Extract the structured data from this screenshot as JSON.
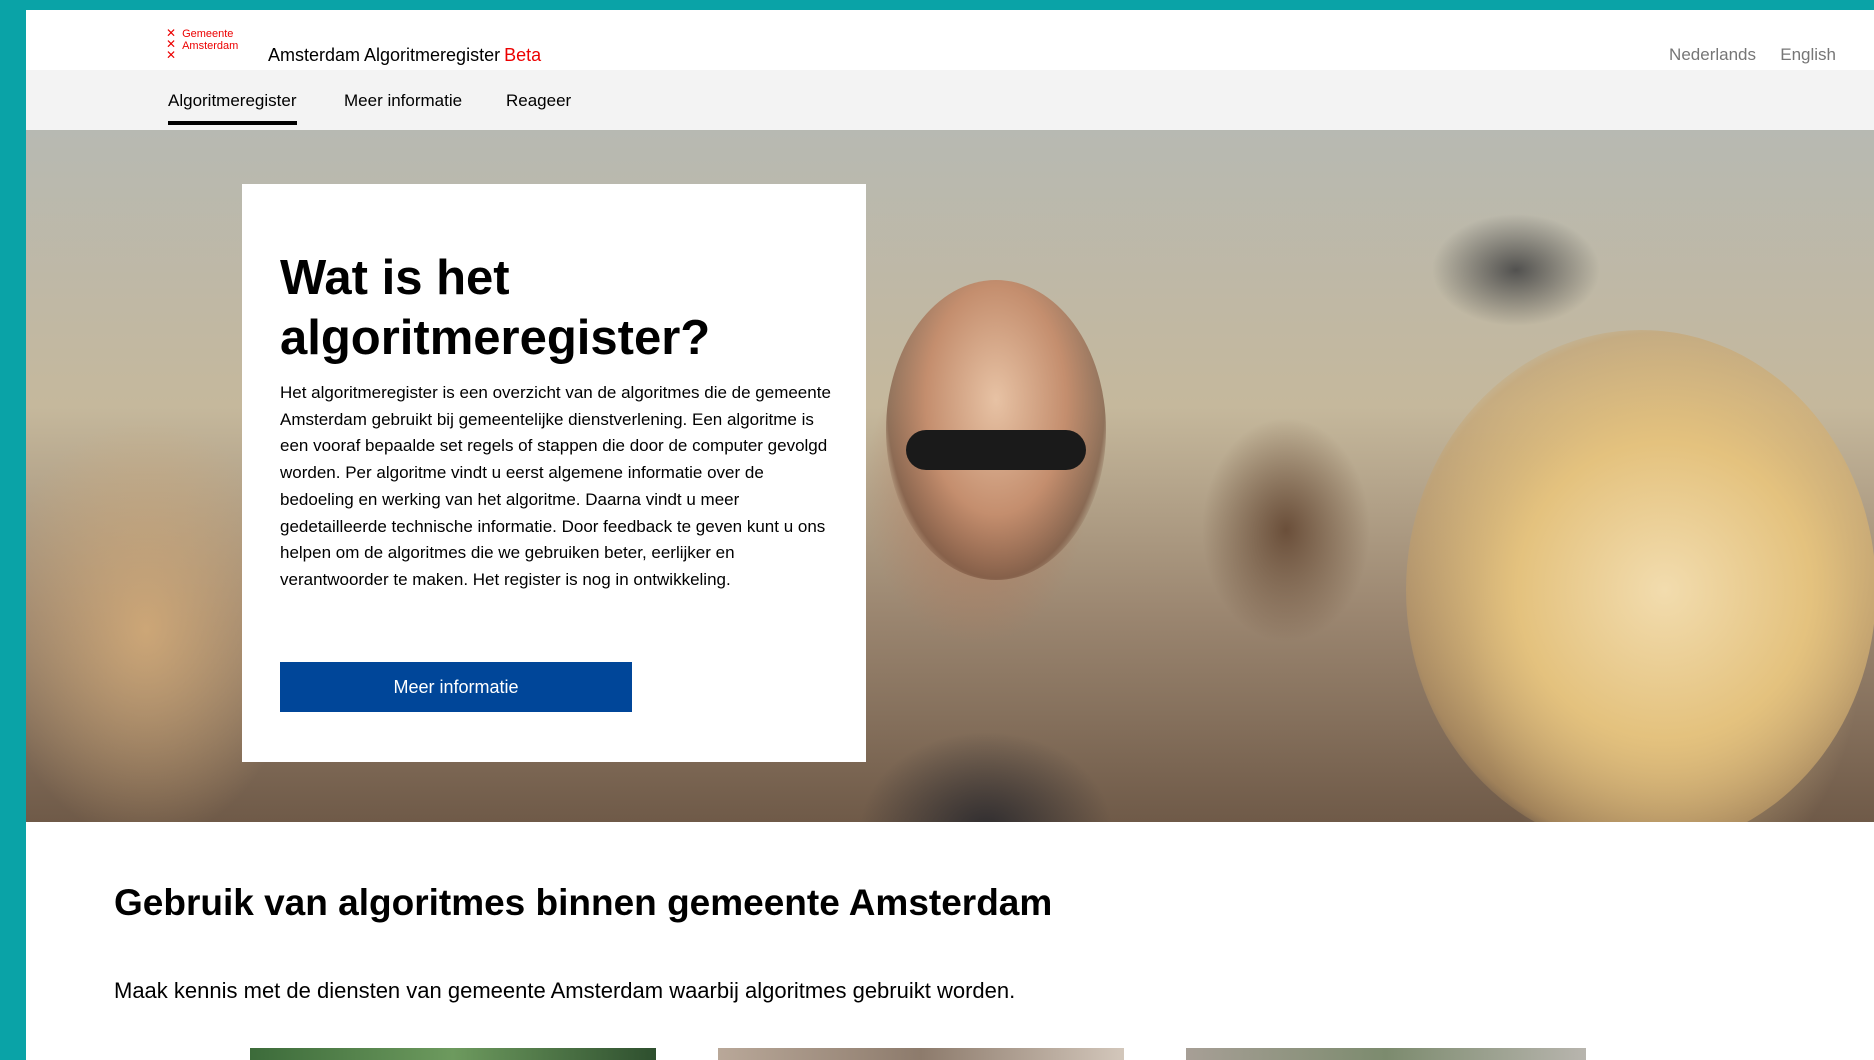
{
  "header": {
    "logo_line1": "Gemeente",
    "logo_line2": "Amsterdam",
    "app_title": "Amsterdam Algoritmeregister",
    "beta_label": "Beta",
    "languages": [
      "Nederlands",
      "English"
    ]
  },
  "nav": {
    "items": [
      "Algoritmeregister",
      "Meer informatie",
      "Reageer"
    ],
    "active": "Algoritmeregister"
  },
  "hero": {
    "heading": "Wat is het algoritmeregister?",
    "body": "Het algoritmeregister is een overzicht van de algoritmes die de gemeente Amsterdam gebruikt bij gemeentelijke dienstverlening. Een algoritme is een vooraf bepaalde set regels of stappen die door de computer gevolgd worden. Per algoritme vindt u eerst algemene informatie over de bedoeling en werking van het algoritme. Daarna vindt u meer gedetailleerde technische informatie. Door feedback te geven kunt u ons helpen om de algoritmes die we gebruiken beter, eerlijker en verantwoorder te maken. Het register is nog in ontwikkeling.",
    "button_label": "Meer informatie"
  },
  "section": {
    "title": "Gebruik van algoritmes binnen gemeente Amsterdam",
    "intro": "Maak kennis met de diensten van gemeente Amsterdam waarbij algoritmes gebruikt worden."
  },
  "colors": {
    "page_border": "#0aa3a7",
    "brand_red": "#ec0000",
    "button_blue": "#004699"
  }
}
